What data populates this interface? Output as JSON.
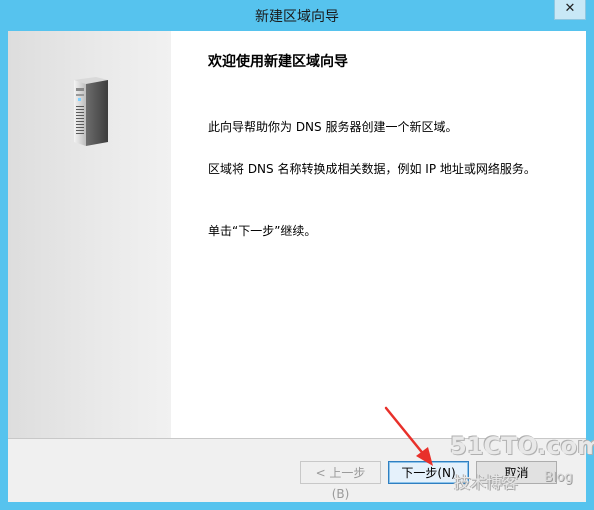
{
  "window": {
    "title": "新建区域向导",
    "close_glyph": "✕"
  },
  "wizard": {
    "heading": "欢迎使用新建区域向导",
    "paragraphs": [
      "此向导帮助你为 DNS 服务器创建一个新区域。",
      "区域将 DNS 名称转换成相关数据，例如 IP 地址或网络服务。",
      "单击“下一步”继续。"
    ],
    "side_icon": "server-icon"
  },
  "buttons": {
    "back": "< 上一步(B)",
    "next": "下一步(N)",
    "cancel": "取消"
  },
  "annotation": {
    "arrow_color": "#e8302a"
  },
  "watermark": {
    "site": "51CTO.com",
    "tagline": "技术博客",
    "blog": "Blog"
  }
}
